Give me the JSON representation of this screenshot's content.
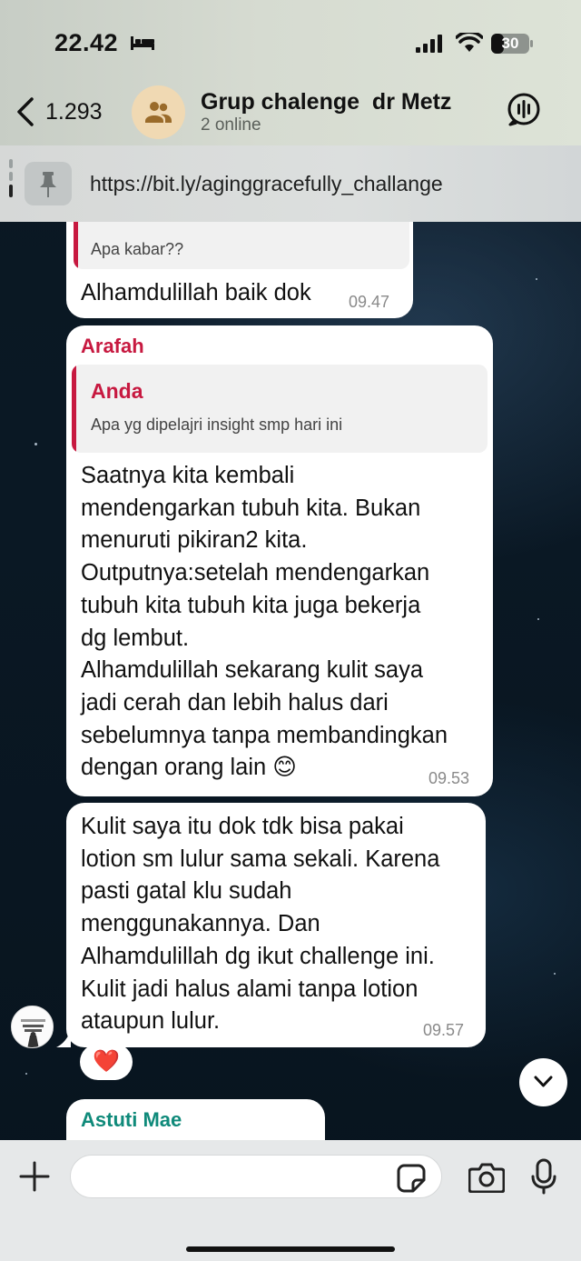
{
  "status_bar": {
    "time": "22.42",
    "battery": "30"
  },
  "header": {
    "back_count": "1.293",
    "title": "Grup chalenge  dr Metz",
    "subtitle": "2 online"
  },
  "pinned": {
    "text": "https://bit.ly/aginggracefully_challange"
  },
  "messages": [
    {
      "quote_text": "Apa kabar??",
      "text": "Alhamdulillah baik dok",
      "time": "09.47"
    },
    {
      "sender": "Arafah",
      "sender_color": "#c71940",
      "quote_name": "Anda",
      "quote_text": "Apa yg dipelajri insight smp hari ini",
      "lines": [
        "Saatnya kita kembali",
        "mendengarkan tubuh kita. Bukan",
        "menuruti pikiran2 kita.",
        "Outputnya:setelah mendengarkan",
        "tubuh kita tubuh kita juga bekerja",
        "dg lembut.",
        "Alhamdulillah sekarang kulit saya",
        "jadi cerah dan lebih halus dari",
        "sebelumnya tanpa membandingkan",
        "dengan orang lain 😊"
      ],
      "time": "09.53"
    },
    {
      "lines": [
        "Kulit saya itu dok tdk bisa pakai",
        "lotion sm lulur sama sekali. Karena",
        "pasti gatal klu sudah",
        "menggunakannya. Dan",
        "Alhamdulillah dg ikut challenge ini.",
        "Kulit jadi halus alami tanpa lotion",
        "ataupun lulur."
      ],
      "time": "09.57",
      "reaction": "❤️"
    },
    {
      "sender": "Astuti Mae",
      "sender_color": "#0f8a7a"
    }
  ],
  "input": {
    "placeholder": ""
  },
  "icons": {
    "back": "chevron-left-icon",
    "group": "group-icon",
    "voicechat": "voice-chat-icon",
    "pin": "pin-icon",
    "scroll": "chevron-down-icon",
    "attach": "plus-icon",
    "sticker": "sticker-icon",
    "camera": "camera-icon",
    "mic": "microphone-icon"
  },
  "colors": {
    "accent_red": "#c71940",
    "accent_teal": "#0f8a7a",
    "bubble": "#ffffff"
  }
}
